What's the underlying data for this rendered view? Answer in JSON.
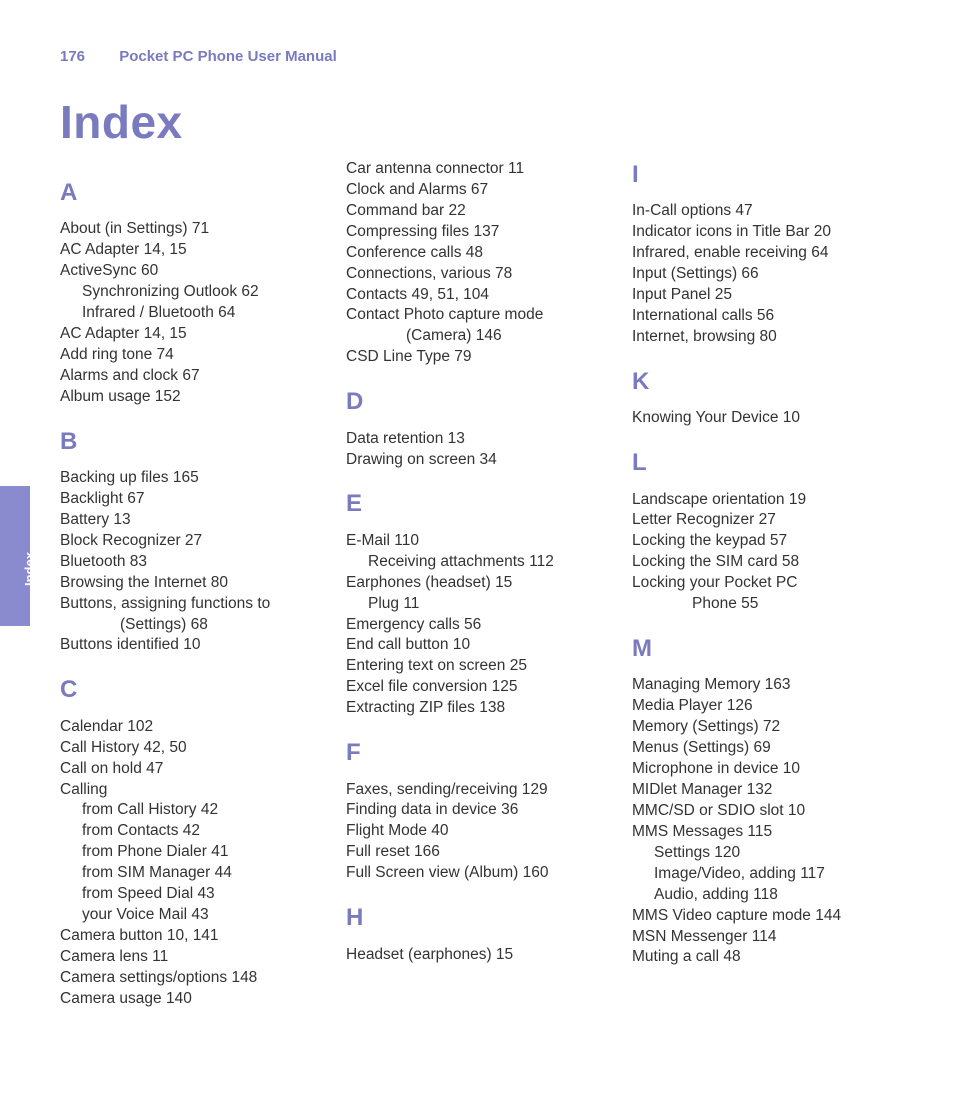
{
  "header": {
    "page_num": "176",
    "title": "Pocket PC Phone User Manual"
  },
  "main_title": "Index",
  "side_tab": "Index",
  "sections": [
    {
      "letter": "A",
      "lines": [
        "About  (in Settings)  71",
        "AC Adapter  14, 15",
        "ActiveSync  60",
        {
          "sub": "Synchronizing Outlook  62"
        },
        {
          "sub": "Infrared / Bluetooth  64"
        },
        "AC Adapter  14, 15",
        "Add ring tone  74",
        "Alarms and clock  67",
        "Album usage  152"
      ]
    },
    {
      "letter": "B",
      "lines": [
        "Backing up files  165",
        "Backlight  67",
        "Battery  13",
        "Block Recognizer  27",
        "Bluetooth  83",
        "Browsing the Internet  80",
        "Buttons, assigning functions to",
        {
          "sub2": "(Settings)  68"
        },
        "Buttons identified  10"
      ]
    },
    {
      "letter": "C",
      "lines": [
        "Calendar  102",
        "Call History  42, 50",
        "Call on hold  47",
        "Calling",
        {
          "sub": "from Call History  42"
        },
        {
          "sub": "from Contacts  42"
        },
        {
          "sub": "from Phone Dialer  41"
        },
        {
          "sub": "from SIM Manager  44"
        },
        {
          "sub": "from Speed Dial  43"
        },
        {
          "sub": "your Voice Mail  43"
        },
        "Camera button  10, 141",
        "Camera lens  11",
        "Camera settings/options  148",
        "Camera usage  140"
      ]
    },
    {
      "letter": "",
      "lines": [
        "Car antenna connector  11",
        "Clock and Alarms  67",
        "Command bar  22",
        "Compressing files  137",
        "Conference calls  48",
        "Connections, various  78",
        "Contacts  49, 51, 104",
        "Contact Photo capture mode",
        {
          "sub2": "(Camera)  146"
        },
        "CSD Line Type  79"
      ]
    },
    {
      "letter": "D",
      "lines": [
        "Data retention  13",
        "Drawing on screen  34"
      ]
    },
    {
      "letter": "E",
      "lines": [
        "E-Mail  110",
        {
          "sub": "Receiving attachments  112"
        },
        "Earphones (headset) 15",
        {
          "sub": "Plug  11"
        },
        "Emergency calls  56",
        "End call button  10",
        "Entering text on screen  25",
        "Excel file conversion  125",
        "Extracting ZIP files  138"
      ]
    },
    {
      "letter": "F",
      "lines": [
        "Faxes, sending/receiving  129",
        "Finding data in device  36",
        "Flight Mode  40",
        "Full reset  166",
        "Full Screen view (Album)  160"
      ]
    },
    {
      "letter": "H",
      "lines": [
        "Headset (earphones)  15"
      ]
    },
    {
      "letter": "I",
      "lines": [
        "In-Call options  47",
        "Indicator icons in Title Bar  20",
        "Infrared, enable receiving  64",
        "Input (Settings)  66",
        "Input Panel  25",
        "International calls  56",
        "Internet, browsing  80"
      ]
    },
    {
      "letter": "K",
      "lines": [
        "Knowing Your Device  10"
      ]
    },
    {
      "letter": "L",
      "lines": [
        "Landscape orientation  19",
        "Letter Recognizer  27",
        "Locking the keypad  57",
        "Locking the SIM card  58",
        "Locking your Pocket PC",
        {
          "sub2": "Phone  55"
        }
      ]
    },
    {
      "letter": "M",
      "lines": [
        "Managing Memory  163",
        "Media Player  126",
        "Memory (Settings)  72",
        "Menus (Settings)  69",
        "Microphone in device  10",
        "MIDlet Manager  132",
        "MMC/SD or SDIO slot  10",
        "MMS Messages  115",
        {
          "sub": "Settings  120"
        },
        {
          "sub": "Image/Video, adding  117"
        },
        {
          "sub": "Audio, adding  118"
        },
        "MMS Video capture mode  144",
        "MSN Messenger  114",
        "Muting a call  48"
      ]
    }
  ]
}
